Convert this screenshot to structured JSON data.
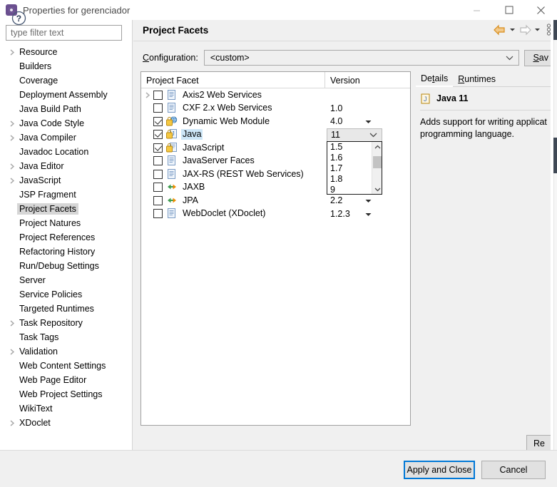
{
  "window": {
    "title": "Properties for gerenciador",
    "icon": "properties-cog-icon",
    "minimize_label": "Minimize",
    "maximize_label": "Maximize",
    "close_label": "Close"
  },
  "sidebar": {
    "filter_placeholder": "type filter text",
    "filter_value": "",
    "selected": "Project Facets",
    "items": [
      {
        "label": "Resource",
        "expandable": true
      },
      {
        "label": "Builders",
        "expandable": false
      },
      {
        "label": "Coverage",
        "expandable": false
      },
      {
        "label": "Deployment Assembly",
        "expandable": false
      },
      {
        "label": "Java Build Path",
        "expandable": false
      },
      {
        "label": "Java Code Style",
        "expandable": true
      },
      {
        "label": "Java Compiler",
        "expandable": true
      },
      {
        "label": "Javadoc Location",
        "expandable": false
      },
      {
        "label": "Java Editor",
        "expandable": true
      },
      {
        "label": "JavaScript",
        "expandable": true
      },
      {
        "label": "JSP Fragment",
        "expandable": false
      },
      {
        "label": "Project Facets",
        "expandable": false
      },
      {
        "label": "Project Natures",
        "expandable": false
      },
      {
        "label": "Project References",
        "expandable": false
      },
      {
        "label": "Refactoring History",
        "expandable": false
      },
      {
        "label": "Run/Debug Settings",
        "expandable": false
      },
      {
        "label": "Server",
        "expandable": false
      },
      {
        "label": "Service Policies",
        "expandable": false
      },
      {
        "label": "Targeted Runtimes",
        "expandable": false
      },
      {
        "label": "Task Repository",
        "expandable": true
      },
      {
        "label": "Task Tags",
        "expandable": false
      },
      {
        "label": "Validation",
        "expandable": true
      },
      {
        "label": "Web Content Settings",
        "expandable": false
      },
      {
        "label": "Web Page Editor",
        "expandable": false
      },
      {
        "label": "Web Project Settings",
        "expandable": false
      },
      {
        "label": "WikiText",
        "expandable": false
      },
      {
        "label": "XDoclet",
        "expandable": true
      }
    ]
  },
  "page": {
    "title": "Project Facets",
    "nav": {
      "back_icon": "back-arrow-icon",
      "back_menu_icon": "chevron-down-icon",
      "forward_icon": "forward-arrow-icon",
      "forward_menu_icon": "chevron-down-icon",
      "view_menu_icon": "vertical-dots-icon"
    }
  },
  "configuration": {
    "label": "Configuration:",
    "label_mnemonic": "C",
    "value": "<custom>",
    "save_label": "Sav",
    "save_mnemonic": "S"
  },
  "facet_table": {
    "columns": [
      "Project Facet",
      "Version"
    ],
    "rows": [
      {
        "name": "Axis2 Web Services",
        "checked": false,
        "version": "",
        "icon": "document-icon",
        "expandable": true,
        "locked": false,
        "has_dropdown": false
      },
      {
        "name": "CXF 2.x Web Services",
        "checked": false,
        "version": "1.0",
        "icon": "document-icon",
        "expandable": false,
        "locked": false,
        "has_dropdown": false
      },
      {
        "name": "Dynamic Web Module",
        "checked": true,
        "version": "4.0",
        "icon": "web-module-icon",
        "expandable": false,
        "locked": true,
        "has_dropdown": true
      },
      {
        "name": "Java",
        "checked": true,
        "version": "11",
        "icon": "java-icon",
        "expandable": false,
        "locked": true,
        "has_dropdown": true,
        "selected": true,
        "combo_open": true
      },
      {
        "name": "JavaScript",
        "checked": true,
        "version": "",
        "icon": "javascript-icon",
        "expandable": false,
        "locked": true,
        "has_dropdown": false
      },
      {
        "name": "JavaServer Faces",
        "checked": false,
        "version": "",
        "icon": "document-icon",
        "expandable": false,
        "locked": false,
        "has_dropdown": false
      },
      {
        "name": "JAX-RS (REST Web Services)",
        "checked": false,
        "version": "",
        "icon": "document-icon",
        "expandable": false,
        "locked": false,
        "has_dropdown": false
      },
      {
        "name": "JAXB",
        "checked": false,
        "version": "",
        "icon": "jaxb-icon",
        "expandable": false,
        "locked": false,
        "has_dropdown": false
      },
      {
        "name": "JPA",
        "checked": false,
        "version": "2.2",
        "icon": "jpa-icon",
        "expandable": false,
        "locked": false,
        "has_dropdown": true
      },
      {
        "name": "WebDoclet (XDoclet)",
        "checked": false,
        "version": "1.2.3",
        "icon": "document-icon",
        "expandable": false,
        "locked": false,
        "has_dropdown": true
      }
    ],
    "version_dropdown": {
      "open": true,
      "selected": "11",
      "options": [
        "1.5",
        "1.6",
        "1.7",
        "1.8",
        "9"
      ],
      "scroll_up_icon": "chevron-up-icon",
      "scroll_down_icon": "chevron-down-icon"
    }
  },
  "details": {
    "tabs": [
      {
        "label": "Details",
        "active": true,
        "mnemonic": "t"
      },
      {
        "label": "Runtimes",
        "active": false,
        "mnemonic": "R"
      }
    ],
    "facet_icon": "java-icon",
    "facet_name": "Java 11",
    "description_lines": [
      "Adds support for writing applicat",
      "programming language."
    ]
  },
  "restore": {
    "label": "Re"
  },
  "scrollbar": {
    "left_arrow_icon": "chevron-left-icon",
    "right_arrow_icon": "chevron-right-icon"
  },
  "footer": {
    "help_icon": "help-question-icon",
    "apply_label": "Apply and Close",
    "cancel_label": "Cancel"
  },
  "colors": {
    "accent": "#0078d7",
    "selection": "#cde6f7",
    "tree_selection": "#d6d6d6",
    "dialog_bg": "#f0f0f0",
    "back_arrow": "#e8a33d"
  }
}
